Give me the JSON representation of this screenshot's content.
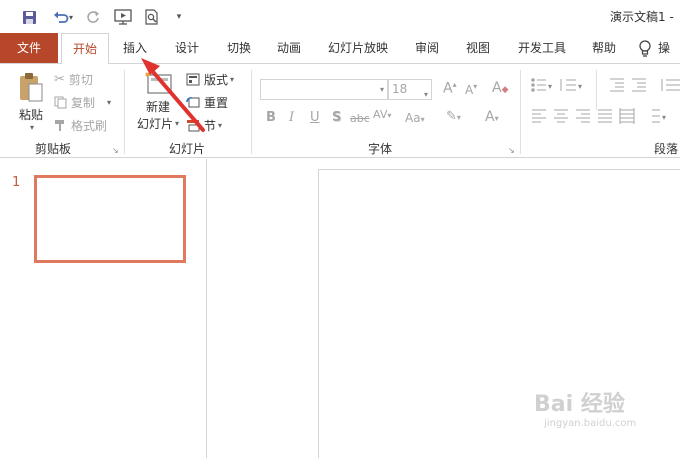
{
  "app": {
    "title": "演示文稿1 -",
    "accent_color": "#b7472a",
    "selection_color": "#e07a5f"
  },
  "qat": {
    "icons": [
      "save-icon",
      "undo-icon",
      "redo-icon",
      "start-from-beginning-icon",
      "print-preview-icon",
      "customize-qat-icon"
    ],
    "undo_dropdown": "▾",
    "customize": "▾"
  },
  "tabs": {
    "file": "文件",
    "home": "开始",
    "insert": "插入",
    "design": "设计",
    "transitions": "切换",
    "animations": "动画",
    "slideshow": "幻灯片放映",
    "review": "审阅",
    "view": "视图",
    "developer": "开发工具",
    "help": "帮助",
    "tell_me_partial": "操"
  },
  "ribbon": {
    "clipboard": {
      "group_label": "剪贴板",
      "paste": "粘贴",
      "cut": "剪切",
      "copy": "复制",
      "format_painter": "格式刷"
    },
    "slides": {
      "group_label": "幻灯片",
      "new_slide_line1": "新建",
      "new_slide_line2": "幻灯片",
      "layout": "版式",
      "reset": "重置",
      "section": "节"
    },
    "font": {
      "group_label": "字体",
      "font_name": "",
      "font_size": "18",
      "grow": "A",
      "shrink": "A",
      "clear": "A",
      "bold": "B",
      "italic": "I",
      "underline": "U",
      "shadow": "S",
      "strikethrough": "abc",
      "spacing": "AV",
      "change_case": "Aa",
      "font_color": "A"
    },
    "paragraph": {
      "group_label": "段落"
    }
  },
  "slides_pane": {
    "slide_number": "1"
  },
  "watermark": {
    "main": "Bai 经验",
    "sub": "jingyan.baidu.com"
  }
}
